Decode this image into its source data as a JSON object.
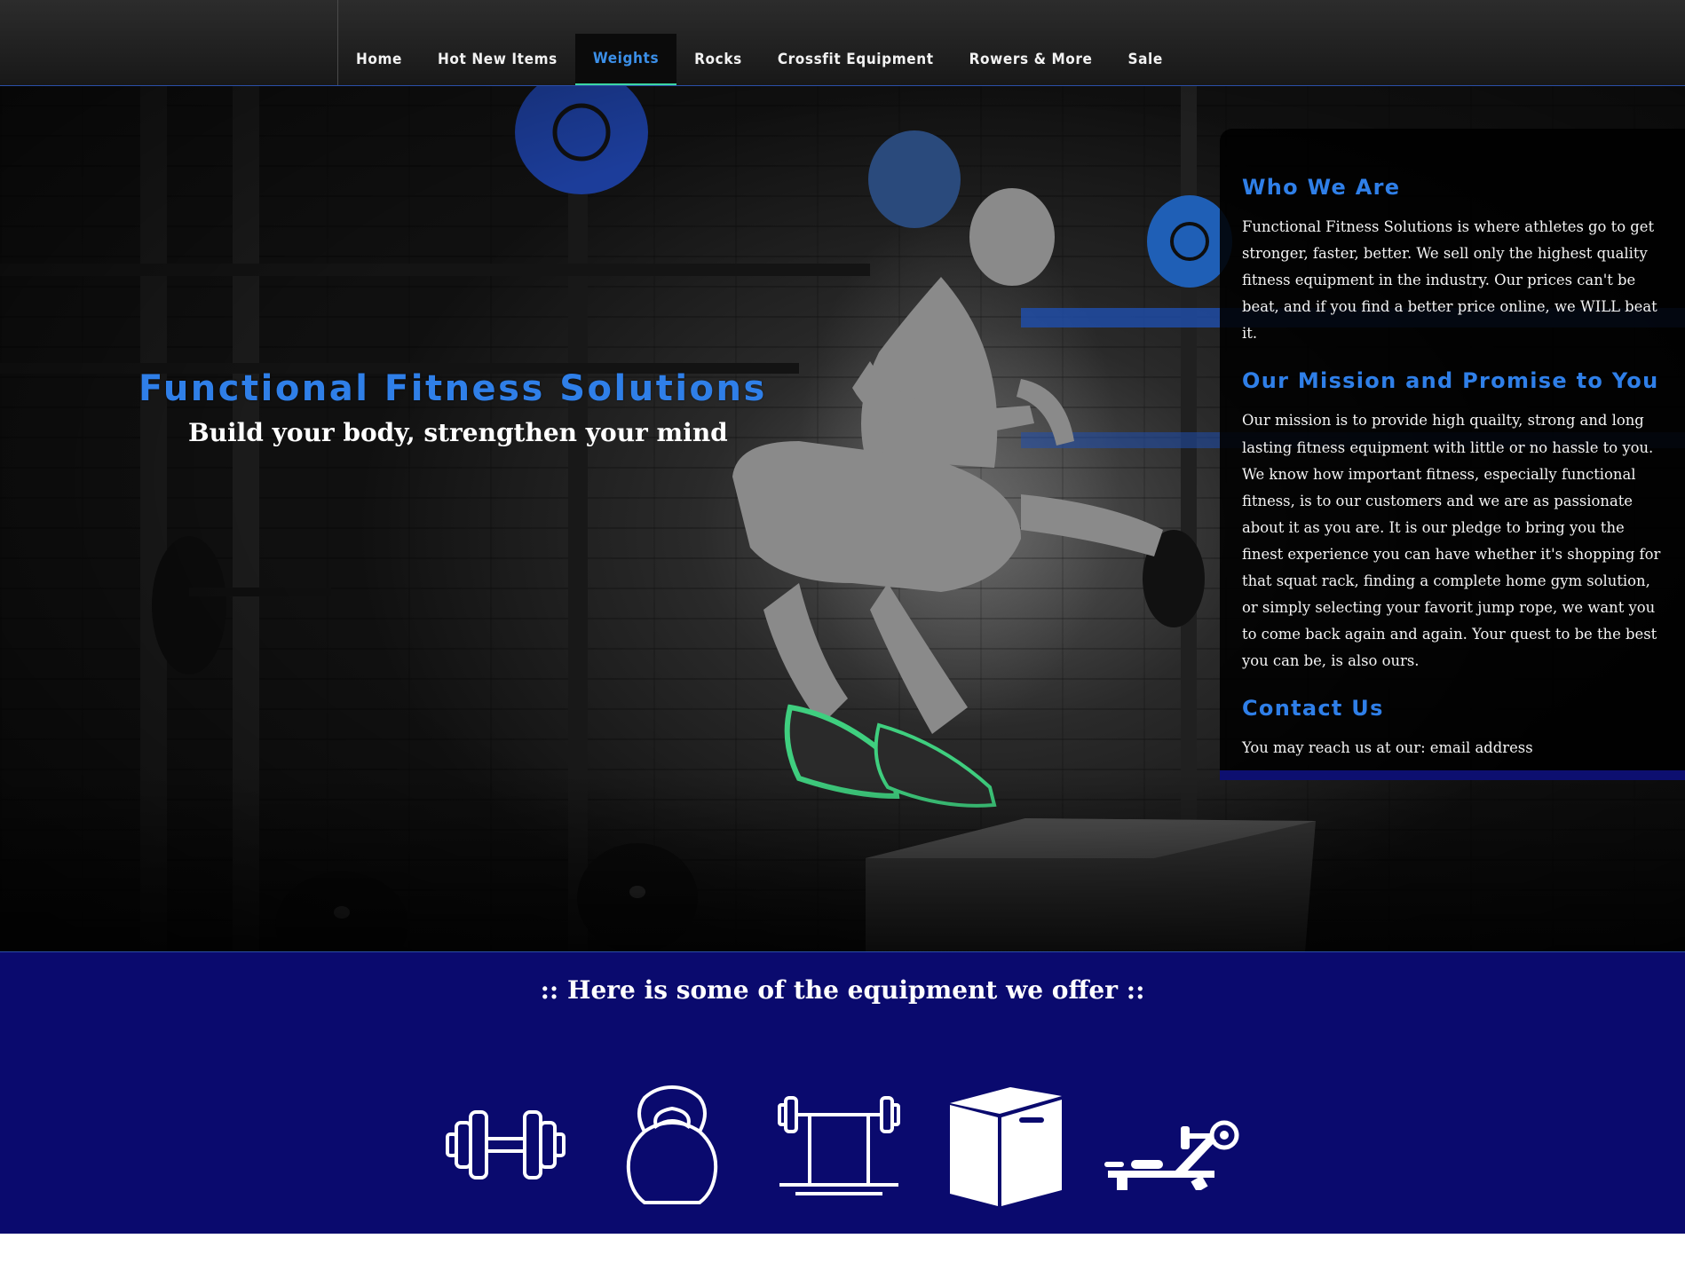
{
  "nav": {
    "items": [
      {
        "label": "Home",
        "active": false
      },
      {
        "label": "Hot New Items",
        "active": false
      },
      {
        "label": "Weights",
        "active": true
      },
      {
        "label": "Rocks",
        "active": false
      },
      {
        "label": "Crossfit Equipment",
        "active": false
      },
      {
        "label": "Rowers & More",
        "active": false
      },
      {
        "label": "Sale",
        "active": false
      }
    ]
  },
  "hero": {
    "title": "Functional Fitness Solutions",
    "subtitle": "Build your body, strengthen your mind"
  },
  "info": {
    "who_heading": "Who We Are",
    "who_text": "Functional Fitness Solutions is where athletes go to get stronger, faster, better. We sell only the highest quality fitness equipment in the industry. Our prices can't be beat, and if you find a better price online, we WILL beat it.",
    "mission_heading": "Our Mission and Promise to You",
    "mission_text": "Our mission is to provide high quailty, strong and long lasting fitness equipment with little or no hassle to you. We know how important fitness, especially functional fitness, is to our customers and we are as passionate about it as you are. It is our pledge to bring you the finest experience you can have whether it's shopping for that squat rack, finding a complete home gym solution, or simply selecting your favorit jump rope, we want you to come back again and again. Your quest to be the best you can be, is also ours.",
    "contact_heading": "Contact Us",
    "contact_text": "You may reach us at our: email address"
  },
  "equipment": {
    "title": ":: Here is some of the equipment we offer ::",
    "icons": [
      "dumbbell-icon",
      "kettlebell-icon",
      "squat-rack-icon",
      "plyo-box-icon",
      "rowing-machine-icon"
    ]
  },
  "colors": {
    "accent_blue": "#2f7fe8",
    "band_navy": "#0a0a6e",
    "active_underline": "#3dd6a3"
  }
}
